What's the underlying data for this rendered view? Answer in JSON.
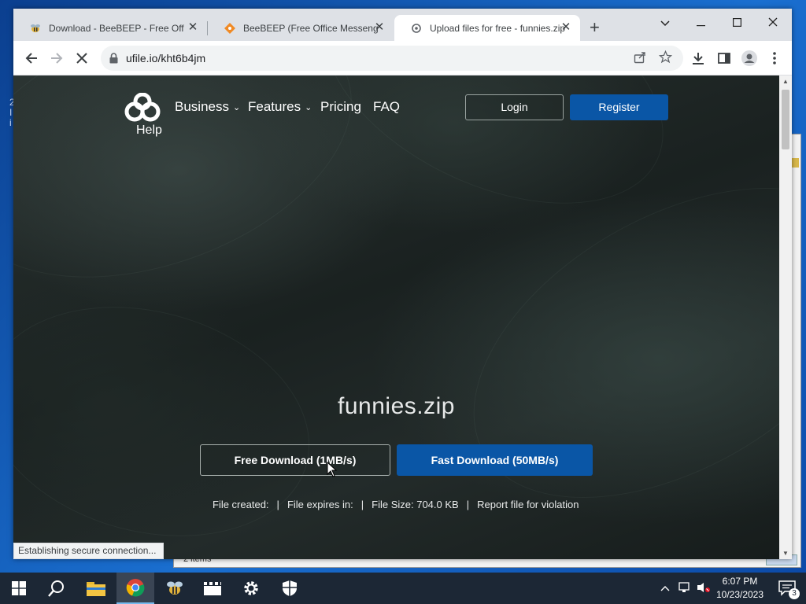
{
  "desktop": {
    "bg_window_items": "2 items",
    "marks": [
      "2",
      "I",
      "i"
    ]
  },
  "tabs": [
    {
      "title": "Download - BeeBEEP - Free Offic"
    },
    {
      "title": "BeeBEEP (Free Office Messenger"
    },
    {
      "title": "Upload files for free - funnies.zip"
    }
  ],
  "toolbar": {
    "url": "ufile.io/kht6b4jm"
  },
  "site": {
    "help": "Help",
    "nav": {
      "business": "Business",
      "features": "Features",
      "pricing": "Pricing",
      "faq": "FAQ"
    },
    "login": "Login",
    "register": "Register",
    "filename": "funnies.zip",
    "free_download": "Free Download (1MB/s)",
    "fast_download": "Fast Download (50MB/s)",
    "meta": {
      "created": "File created:",
      "expires": "File expires in:",
      "size": "File Size: 704.0 KB",
      "report": "Report file for violation",
      "separator": "|"
    },
    "accent_color": "#0a56a6"
  },
  "status_bar": "Establishing secure connection...",
  "taskbar": {
    "time": "6:07 PM",
    "date": "10/23/2023",
    "notification_count": "3"
  }
}
